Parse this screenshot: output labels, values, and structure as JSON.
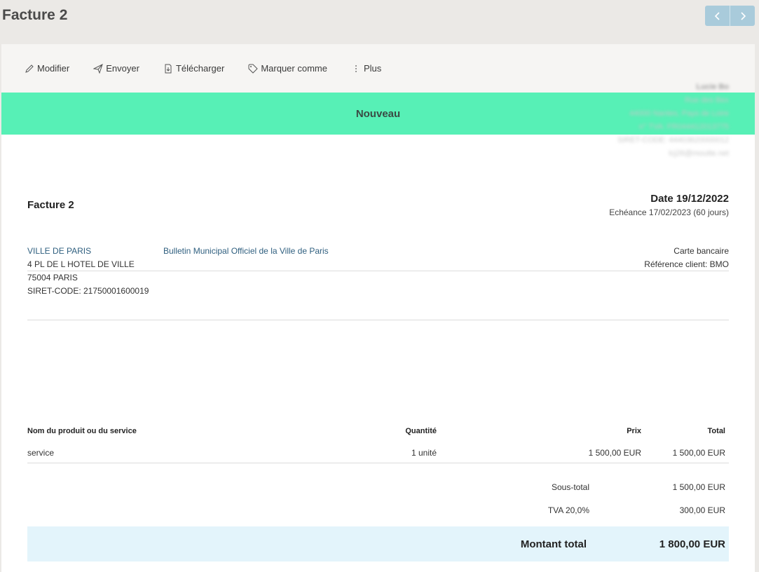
{
  "header": {
    "title": "Facture 2"
  },
  "toolbar": {
    "modifier": "Modifier",
    "envoyer": "Envoyer",
    "telecharger": "Télécharger",
    "marquer": "Marquer comme",
    "plus": "Plus"
  },
  "status": {
    "label": "Nouveau",
    "color": "#57f0b6"
  },
  "company": {
    "name": "Lucie Bo",
    "street": "Rue des Bex",
    "city": "44000 Nantes, Pays de Loire",
    "vat": "n° TVA: FR044412013775",
    "siret": "SIRET-CODE: 44403620000012",
    "email": "lcj26@moutte.net"
  },
  "invoice": {
    "title": "Facture 2",
    "date": "Date 19/12/2022",
    "due": "Echéance 17/02/2023 (60 jours)"
  },
  "client": {
    "name": "VILLE DE PARIS",
    "address1": "4 PL DE L HOTEL DE VILLE",
    "address2": "75004 PARIS",
    "siret": "SIRET-CODE: 21750001600019",
    "project": "Bulletin Municipal Officiel de la Ville de Paris"
  },
  "payment": {
    "method": "Carte bancaire",
    "reference": "Référence client: BMO"
  },
  "lines": {
    "headers": {
      "name": "Nom du produit ou du service",
      "qty": "Quantité",
      "price": "Prix",
      "total": "Total"
    },
    "rows": [
      {
        "name": "service",
        "qty": "1 unité",
        "price": "1 500,00 EUR",
        "total": "1 500,00 EUR"
      }
    ]
  },
  "totals": {
    "subtotal_label": "Sous-total",
    "subtotal": "1 500,00 EUR",
    "tax_label": "TVA 20,0%",
    "tax": "300,00 EUR",
    "grand_label": "Montant total",
    "grand": "1 800,00 EUR"
  }
}
